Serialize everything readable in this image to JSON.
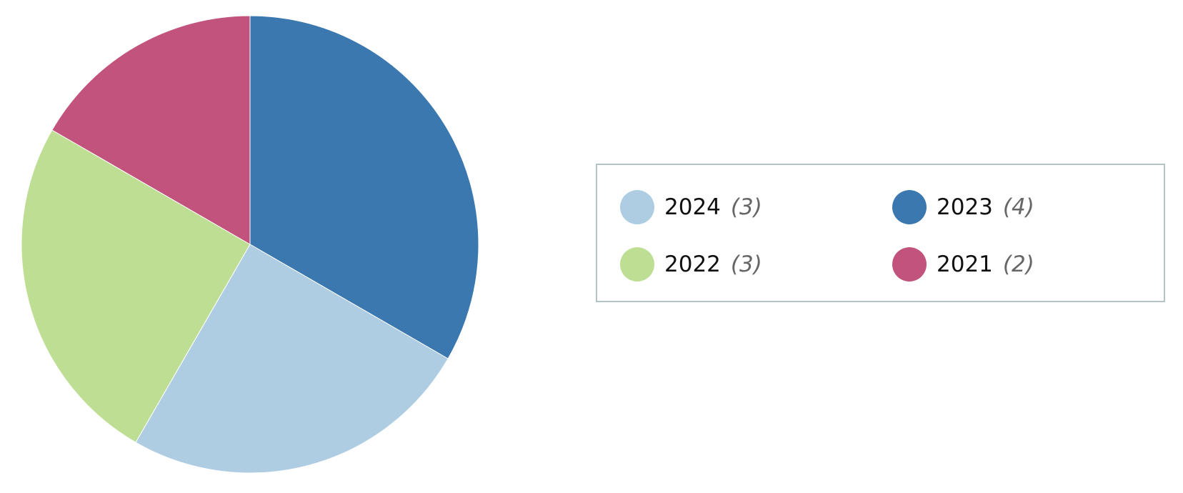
{
  "chart_data": {
    "type": "pie",
    "title": "",
    "legend_placement": "right",
    "slices": [
      {
        "label": "2023",
        "count_text": "(4)",
        "value": 4,
        "color": "#3b78af"
      },
      {
        "label": "2024",
        "count_text": "(3)",
        "value": 3,
        "color": "#aecde2"
      },
      {
        "label": "2022",
        "count_text": "(3)",
        "value": 3,
        "color": "#bede94"
      },
      {
        "label": "2021",
        "count_text": "(2)",
        "value": 2,
        "color": "#c2537c"
      }
    ]
  },
  "legend": {
    "items": [
      {
        "label": "2024",
        "count": "(3)",
        "color": "#aecde2"
      },
      {
        "label": "2023",
        "count": "(4)",
        "color": "#3b78af"
      },
      {
        "label": "2022",
        "count": "(3)",
        "color": "#bede94"
      },
      {
        "label": "2021",
        "count": "(2)",
        "color": "#c2537c"
      }
    ]
  }
}
